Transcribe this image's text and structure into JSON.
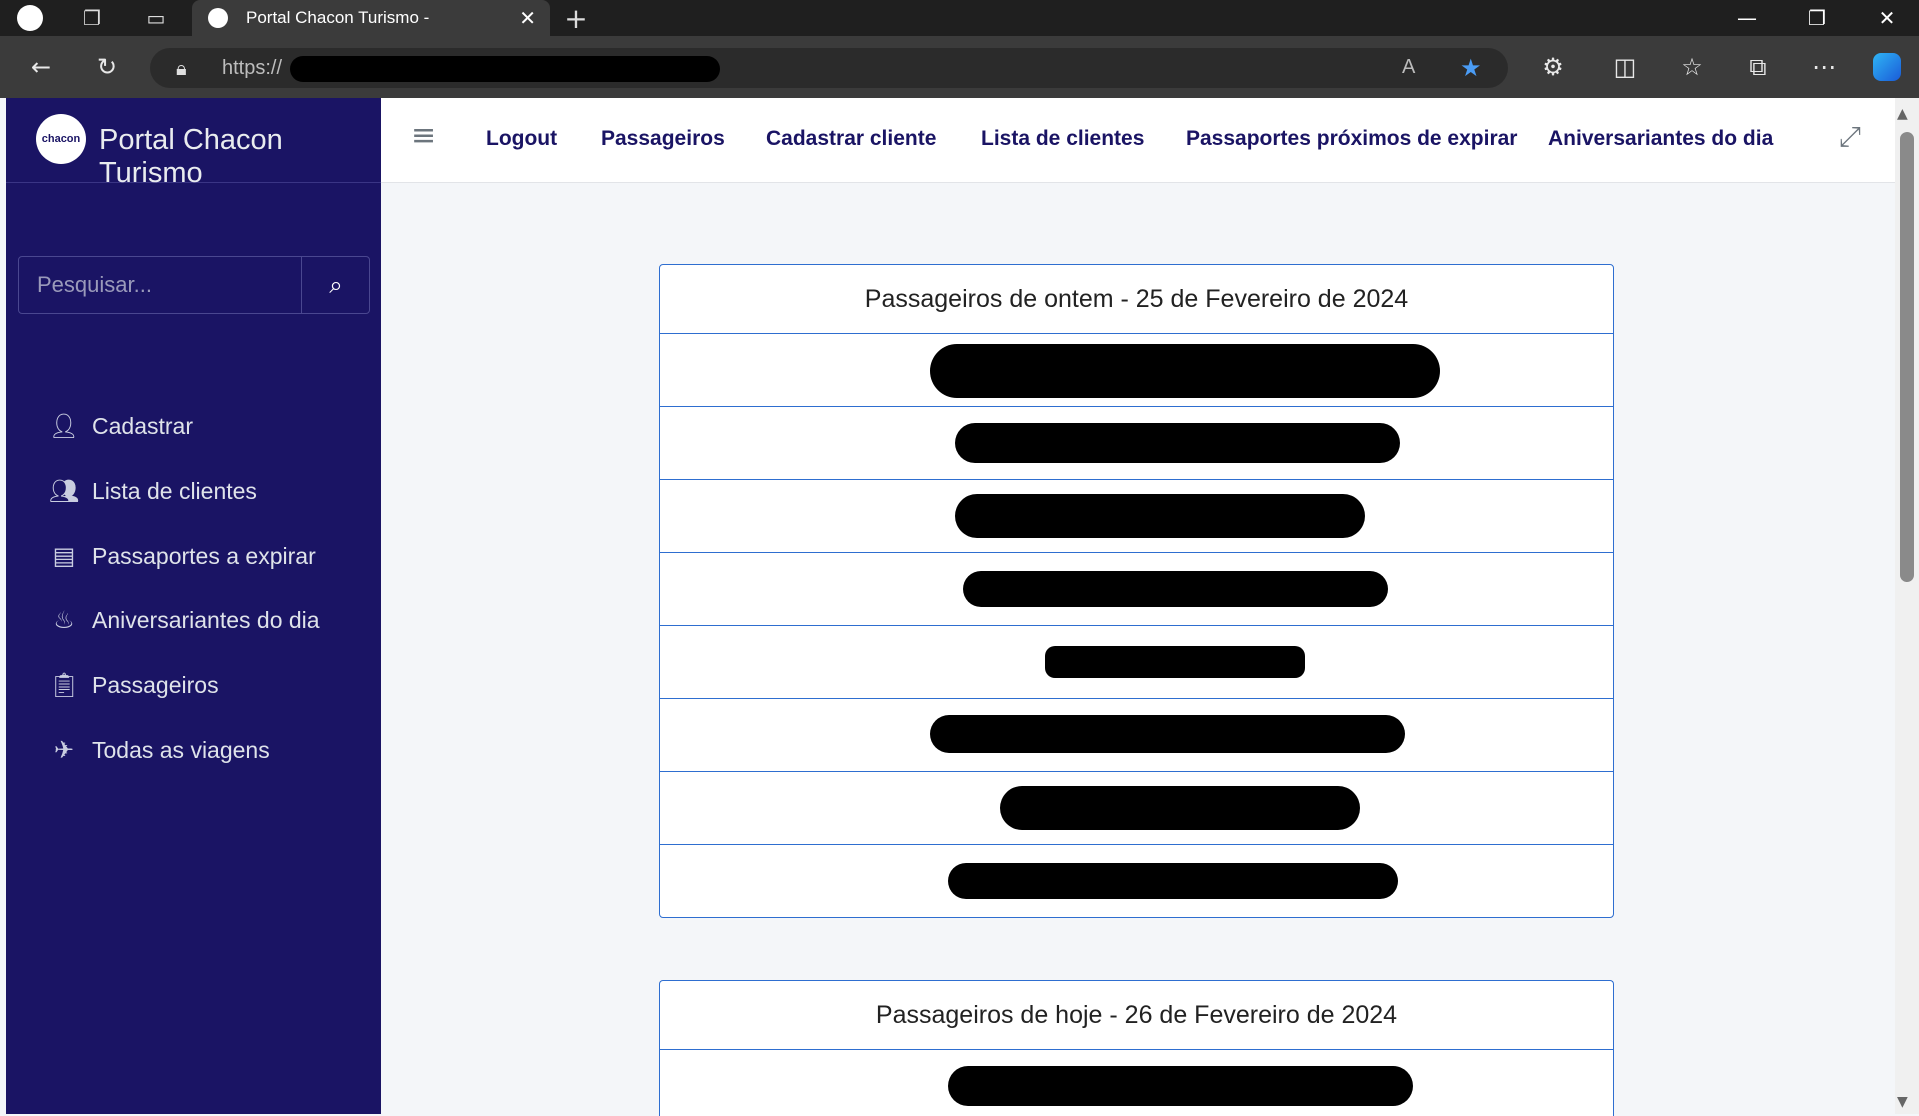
{
  "browser": {
    "tab_title": "Portal Chacon Turismo -",
    "url": "https://",
    "close_tab": "✕",
    "new_tab": "+",
    "minimize": "—",
    "restore": "❐",
    "close_window": "✕"
  },
  "sidebar": {
    "brand": "Portal Chacon Turismo",
    "logo_text": "chacon",
    "search_placeholder": "Pesquisar...",
    "items": [
      {
        "label": "Cadastrar",
        "icon": "user-plus-icon"
      },
      {
        "label": "Lista de clientes",
        "icon": "users-icon"
      },
      {
        "label": "Passaportes a expirar",
        "icon": "id-badge-icon"
      },
      {
        "label": "Aniversariantes do dia",
        "icon": "birthday-cake-icon"
      },
      {
        "label": "Passageiros",
        "icon": "clipboard-list-icon"
      },
      {
        "label": "Todas as viagens",
        "icon": "plane-icon"
      }
    ]
  },
  "topnav": {
    "links": [
      "Logout",
      "Passageiros",
      "Cadastrar cliente",
      "Lista de clientes",
      "Passaportes próximos de expirar",
      "Aniversariantes do dia"
    ]
  },
  "cards": [
    {
      "title": "Passageiros de ontem - 25 de Fevereiro de 2024",
      "row_count": 8
    },
    {
      "title": "Passageiros de hoje - 26 de Fevereiro de 2024",
      "row_count": 1
    }
  ],
  "colors": {
    "sidebar": "#1a1464",
    "accent": "#2e6ed0",
    "nav_text": "#1a1464"
  }
}
